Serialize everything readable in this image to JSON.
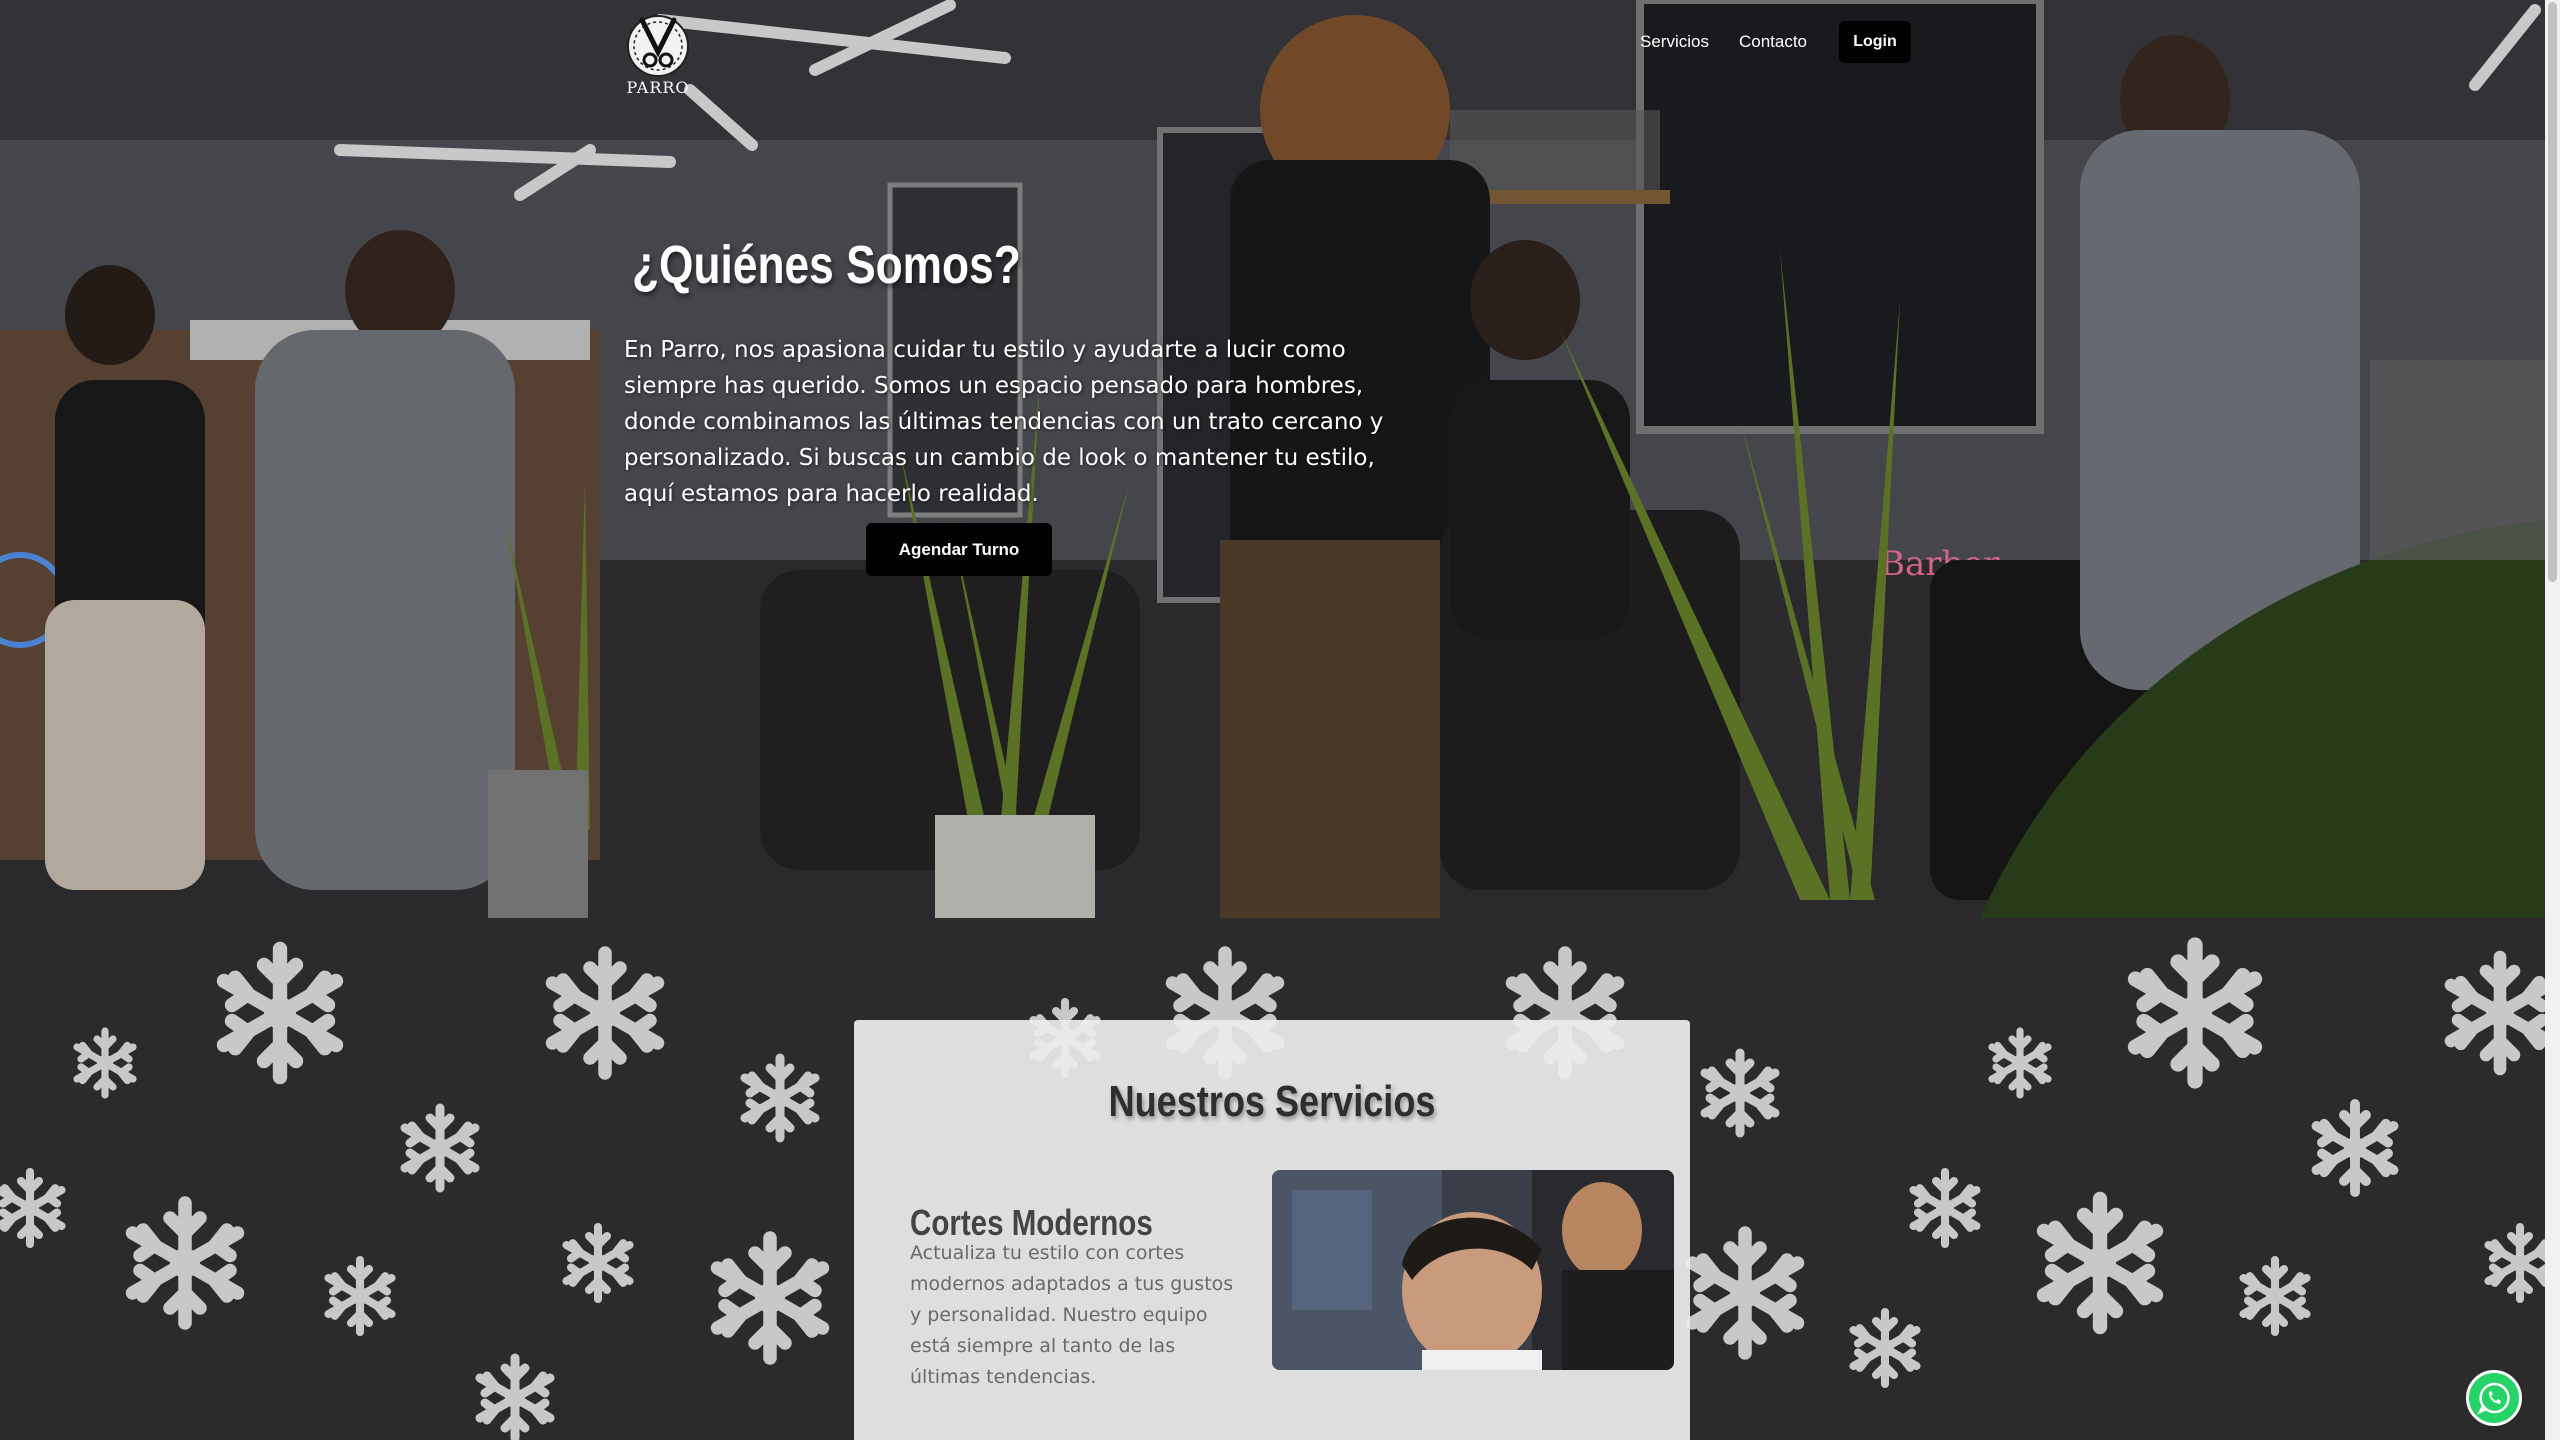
{
  "brand": {
    "logo_text": "PARRO"
  },
  "nav": {
    "items": [
      {
        "label": "Servicios"
      },
      {
        "label": "Contacto"
      }
    ],
    "login_label": "Login"
  },
  "hero": {
    "title": "¿Quiénes Somos?",
    "text": "En Parro, nos apasiona cuidar tu estilo y ayudarte a lucir como siempre has querido. Somos un espacio pensado para hombres, donde combinamos las últimas tendencias con un trato cercano y personalizado. Si buscas un cambio de look o mantener tu estilo, aquí estamos para hacerlo realidad.",
    "cta_label": "Agendar Turno"
  },
  "services": {
    "title": "Nuestros Servicios",
    "items": [
      {
        "title": "Cortes Modernos",
        "description": "Actualiza tu estilo con cortes modernos adaptados a tus gustos y personalidad. Nuestro equipo está siempre al tanto de las últimas tendencias."
      }
    ]
  },
  "colors": {
    "button_bg": "#000000",
    "page_bg": "#2b2b2b",
    "card_bg": "#ececec",
    "whatsapp_green": "#25d366"
  },
  "icons": {
    "logo": "scissors-logo-icon",
    "whatsapp": "whatsapp-icon",
    "decor": "snowflake-icon"
  }
}
